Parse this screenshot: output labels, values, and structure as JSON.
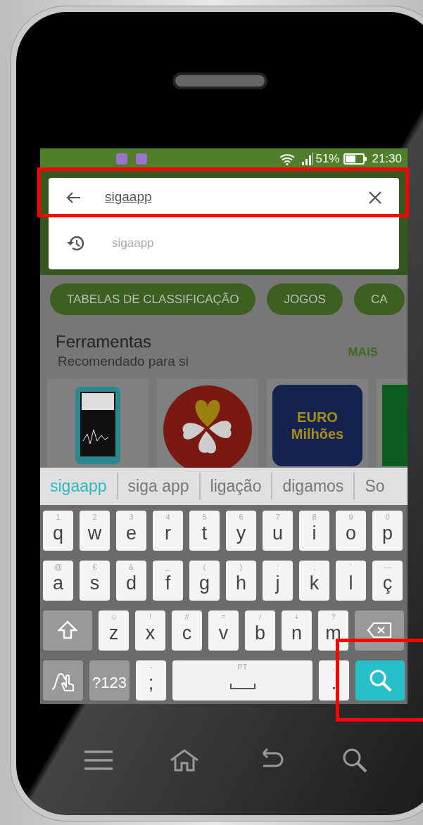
{
  "status_bar": {
    "battery": "51%",
    "time": "21:30"
  },
  "search": {
    "value": "sigaapp"
  },
  "history": [
    {
      "text": "sigaapp"
    }
  ],
  "chips": [
    "TABELAS DE CLASSIFICAÇÃO",
    "JOGOS",
    "CA"
  ],
  "section": {
    "title": "Ferramentas",
    "subtitle": "Recomendado para si",
    "more": "MAIS"
  },
  "apps": [
    {
      "kind": "meter"
    },
    {
      "kind": "clover"
    },
    {
      "kind": "euro",
      "lines": [
        "EURO",
        "Milhões"
      ]
    },
    {
      "kind": "green"
    }
  ],
  "suggestions": [
    {
      "text": "sigaapp",
      "selected": true
    },
    {
      "text": "siga app",
      "selected": false
    },
    {
      "text": "ligação",
      "selected": false
    },
    {
      "text": "digamos",
      "selected": false
    },
    {
      "text": "So",
      "selected": false
    }
  ],
  "keyboard": [
    [
      {
        "kind": "char",
        "label": "q",
        "hint": "1"
      },
      {
        "kind": "char",
        "label": "w",
        "hint": "2"
      },
      {
        "kind": "char",
        "label": "e",
        "hint": "3"
      },
      {
        "kind": "char",
        "label": "r",
        "hint": "4"
      },
      {
        "kind": "char",
        "label": "t",
        "hint": "5"
      },
      {
        "kind": "char",
        "label": "y",
        "hint": "6"
      },
      {
        "kind": "char",
        "label": "u",
        "hint": "7"
      },
      {
        "kind": "char",
        "label": "i",
        "hint": "8"
      },
      {
        "kind": "char",
        "label": "o",
        "hint": "9"
      },
      {
        "kind": "char",
        "label": "p",
        "hint": "0"
      }
    ],
    [
      {
        "kind": "char",
        "label": "a",
        "hint": "@"
      },
      {
        "kind": "char",
        "label": "s",
        "hint": "€"
      },
      {
        "kind": "char",
        "label": "d",
        "hint": "&"
      },
      {
        "kind": "char",
        "label": "f",
        "hint": "_"
      },
      {
        "kind": "char",
        "label": "g",
        "hint": "("
      },
      {
        "kind": "char",
        "label": "h",
        "hint": ")"
      },
      {
        "kind": "char",
        "label": "j",
        "hint": ":"
      },
      {
        "kind": "char",
        "label": "k",
        "hint": ";"
      },
      {
        "kind": "char",
        "label": "l",
        "hint": "'"
      },
      {
        "kind": "char",
        "label": "ç",
        "hint": "—"
      }
    ],
    [
      {
        "kind": "shift"
      },
      {
        "kind": "char",
        "label": "z",
        "hint": "☺"
      },
      {
        "kind": "char",
        "label": "x",
        "hint": "!"
      },
      {
        "kind": "char",
        "label": "c",
        "hint": "#"
      },
      {
        "kind": "char",
        "label": "v",
        "hint": "="
      },
      {
        "kind": "char",
        "label": "b",
        "hint": "/"
      },
      {
        "kind": "char",
        "label": "n",
        "hint": "+"
      },
      {
        "kind": "char",
        "label": "m",
        "hint": "?"
      },
      {
        "kind": "backspace"
      }
    ],
    [
      {
        "kind": "gesture"
      },
      {
        "kind": "symbols",
        "label": "?123"
      },
      {
        "kind": "char",
        "label": ";",
        "hint": "-"
      },
      {
        "kind": "space",
        "hint": "PT"
      },
      {
        "kind": "char",
        "label": ".",
        "hint": ","
      },
      {
        "kind": "search"
      }
    ]
  ]
}
